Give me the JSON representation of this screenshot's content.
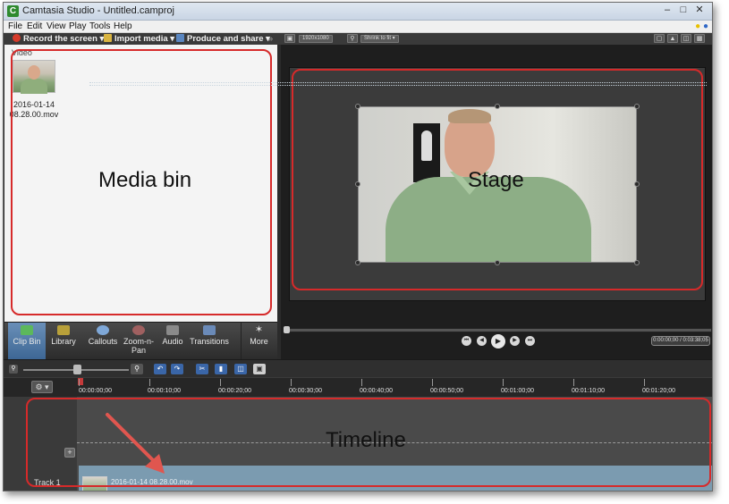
{
  "window": {
    "title": "Camtasia Studio - Untitled.camproj"
  },
  "menu": [
    "File",
    "Edit",
    "View",
    "Play",
    "Tools",
    "Help"
  ],
  "toolbar": {
    "record": "Record the screen",
    "import": "Import media",
    "produce": "Produce and share",
    "resolution": "1920x1080",
    "zoom": "Shrink to fit"
  },
  "media_bin": {
    "section_label": "Video",
    "clip_name_line1": "2016-01-14",
    "clip_name_line2": "08.28.00.mov",
    "annotation": "Media bin"
  },
  "tabs": [
    {
      "label": "Clip Bin",
      "icon": "clip-bin-icon",
      "active": true
    },
    {
      "label": "Library",
      "icon": "library-icon"
    },
    {
      "label": "Callouts",
      "icon": "callouts-icon"
    },
    {
      "label": "Zoom-n-Pan",
      "icon": "zoom-n-pan-icon"
    },
    {
      "label": "Audio",
      "icon": "audio-icon"
    },
    {
      "label": "Transitions",
      "icon": "transitions-icon"
    },
    {
      "label": "More",
      "icon": "more-icon"
    }
  ],
  "stage": {
    "annotation": "Stage"
  },
  "playback": {
    "time": "0:00:00;00 / 0:03:38;05"
  },
  "timeline": {
    "annotation": "Timeline",
    "ticks": [
      "00:00:00;00",
      "00:00:10;00",
      "00:00:20;00",
      "00:00:30;00",
      "00:00:40;00",
      "00:00:50;00",
      "00:01:00;00",
      "00:01:10;00",
      "00:01:20;00"
    ],
    "track1_label": "Track 1",
    "clip_label": "2016-01-14 08.28.00.mov"
  },
  "colors": {
    "highlight": "#d62a2a",
    "active_tab": "#3c6694",
    "track_clip": "#7b9bb0"
  }
}
